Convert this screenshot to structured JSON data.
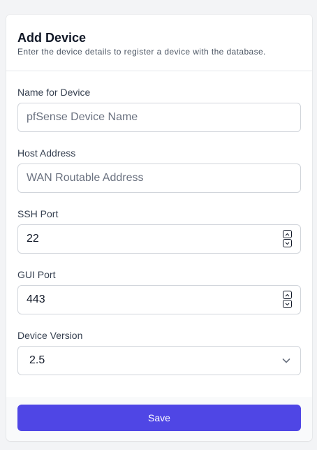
{
  "header": {
    "title": "Add Device",
    "subtitle": "Enter the device details to register a device with the database."
  },
  "fields": {
    "name": {
      "label": "Name for Device",
      "placeholder": "pfSense Device Name",
      "value": ""
    },
    "host": {
      "label": "Host Address",
      "placeholder": "WAN Routable Address",
      "value": ""
    },
    "ssh_port": {
      "label": "SSH Port",
      "value": "22"
    },
    "gui_port": {
      "label": "GUI Port",
      "value": "443"
    },
    "version": {
      "label": "Device Version",
      "selected": "2.5"
    }
  },
  "footer": {
    "save_label": "Save"
  },
  "colors": {
    "accent": "#4f46e5",
    "background": "#f3f4f6",
    "card": "#ffffff"
  },
  "icons": {
    "stepper_up": "chevron-up-icon",
    "stepper_down": "chevron-down-icon",
    "select": "chevron-down-icon"
  }
}
